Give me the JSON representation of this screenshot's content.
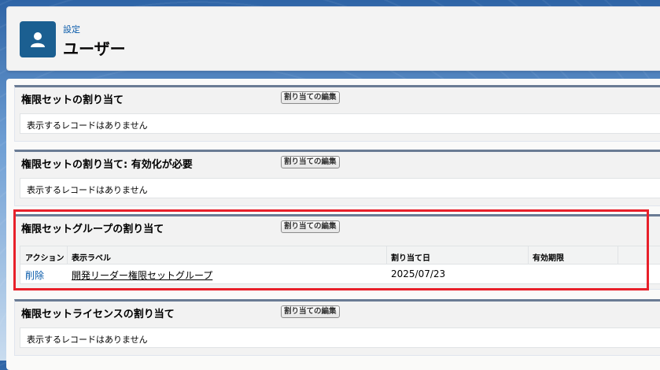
{
  "header": {
    "breadcrumb": "設定",
    "title": "ユーザー",
    "icon": "user-icon"
  },
  "sections": [
    {
      "title": "権限セットの割り当て",
      "edit_label": "割り当ての編集",
      "empty_text": "表示するレコードはありません"
    },
    {
      "title": "権限セットの割り当て: 有効化が必要",
      "edit_label": "割り当ての編集",
      "empty_text": "表示するレコードはありません"
    },
    {
      "title": "権限セットグループの割り当て",
      "edit_label": "割り当ての編集",
      "columns": [
        "アクション",
        "表示ラベル",
        "割り当て日",
        "有効期限"
      ],
      "rows": [
        {
          "action": "削除",
          "label": "開発リーダー権限セットグループ",
          "assigned_date": "2025/07/23",
          "expiry": ""
        }
      ]
    },
    {
      "title": "権限セットライセンスの割り当て",
      "edit_label": "割り当ての編集",
      "empty_text": "表示するレコードはありません"
    }
  ],
  "colors": {
    "highlight": "#e8202a",
    "header_icon_bg": "#1b5f91",
    "link": "#0b5cab"
  }
}
